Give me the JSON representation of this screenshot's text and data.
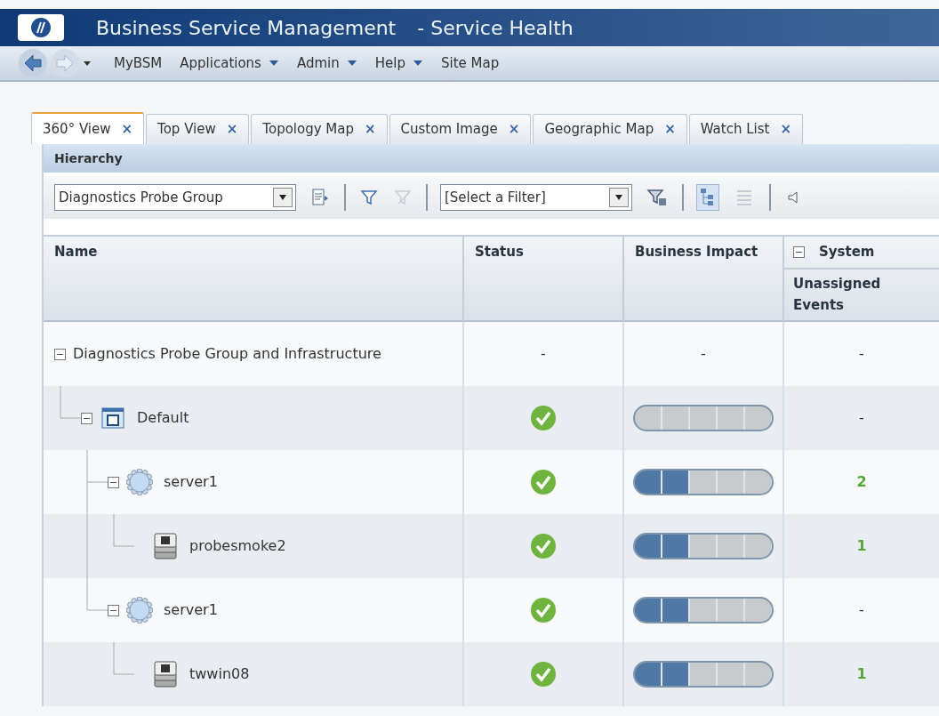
{
  "window": {
    "title": "Business Service Management",
    "subtitle": "- Service Health"
  },
  "nav": {
    "menus": [
      {
        "label": "MyBSM",
        "dropdown": false
      },
      {
        "label": "Applications",
        "dropdown": true
      },
      {
        "label": "Admin",
        "dropdown": true
      },
      {
        "label": "Help",
        "dropdown": true
      },
      {
        "label": "Site Map",
        "dropdown": false
      }
    ]
  },
  "tabs": [
    {
      "label": "360° View",
      "selected": true,
      "close": "×"
    },
    {
      "label": "Top View",
      "selected": false,
      "close": "×"
    },
    {
      "label": "Topology Map",
      "selected": false,
      "close": "×"
    },
    {
      "label": "Custom Image",
      "selected": false,
      "close": "×"
    },
    {
      "label": "Geographic Map",
      "selected": false,
      "close": "×"
    },
    {
      "label": "Watch List",
      "selected": false,
      "close": "×"
    }
  ],
  "panel": {
    "title": "Hierarchy"
  },
  "toolbar": {
    "view_select": "Diagnostics Probe Group",
    "filter_select": "[Select a Filter]",
    "tree_view_selected": true
  },
  "table": {
    "columns": [
      {
        "label": "Name"
      },
      {
        "label": "Status"
      },
      {
        "label": "Business Impact"
      },
      {
        "label": "System",
        "sub": "Unassigned Events",
        "expanded": true
      }
    ],
    "rows": [
      {
        "name": "Diagnostics Probe Group and Infrastructure",
        "expanded": true,
        "status": {
          "kind": "text",
          "text": "-"
        },
        "impact": {
          "kind": "text",
          "text": "-"
        },
        "events": {
          "kind": "text",
          "text": "-"
        },
        "children": [
          {
            "name": "Default",
            "kind": "container",
            "expanded": true,
            "status": {
              "kind": "ok"
            },
            "impact": {
              "kind": "bar",
              "level": 0
            },
            "events": {
              "kind": "text",
              "text": "-"
            },
            "children": [
              {
                "name": "server1",
                "kind": "server",
                "expanded": true,
                "status": {
                  "kind": "ok"
                },
                "impact": {
                  "kind": "bar",
                  "level": 0.4
                },
                "events": {
                  "kind": "count",
                  "text": "2"
                },
                "children": [
                  {
                    "name": "probesmoke2",
                    "kind": "host",
                    "status": {
                      "kind": "ok"
                    },
                    "impact": {
                      "kind": "bar",
                      "level": 0.4
                    },
                    "events": {
                      "kind": "count",
                      "text": "1"
                    }
                  }
                ]
              },
              {
                "name": "server1",
                "kind": "server",
                "expanded": true,
                "status": {
                  "kind": "ok"
                },
                "impact": {
                  "kind": "bar",
                  "level": 0.4
                },
                "events": {
                  "kind": "text",
                  "text": "-"
                },
                "children": [
                  {
                    "name": "twwin08",
                    "kind": "host",
                    "status": {
                      "kind": "ok"
                    },
                    "impact": {
                      "kind": "bar",
                      "level": 0.4
                    },
                    "events": {
                      "kind": "count",
                      "text": "1"
                    }
                  }
                ]
              }
            ]
          }
        ]
      }
    ]
  }
}
